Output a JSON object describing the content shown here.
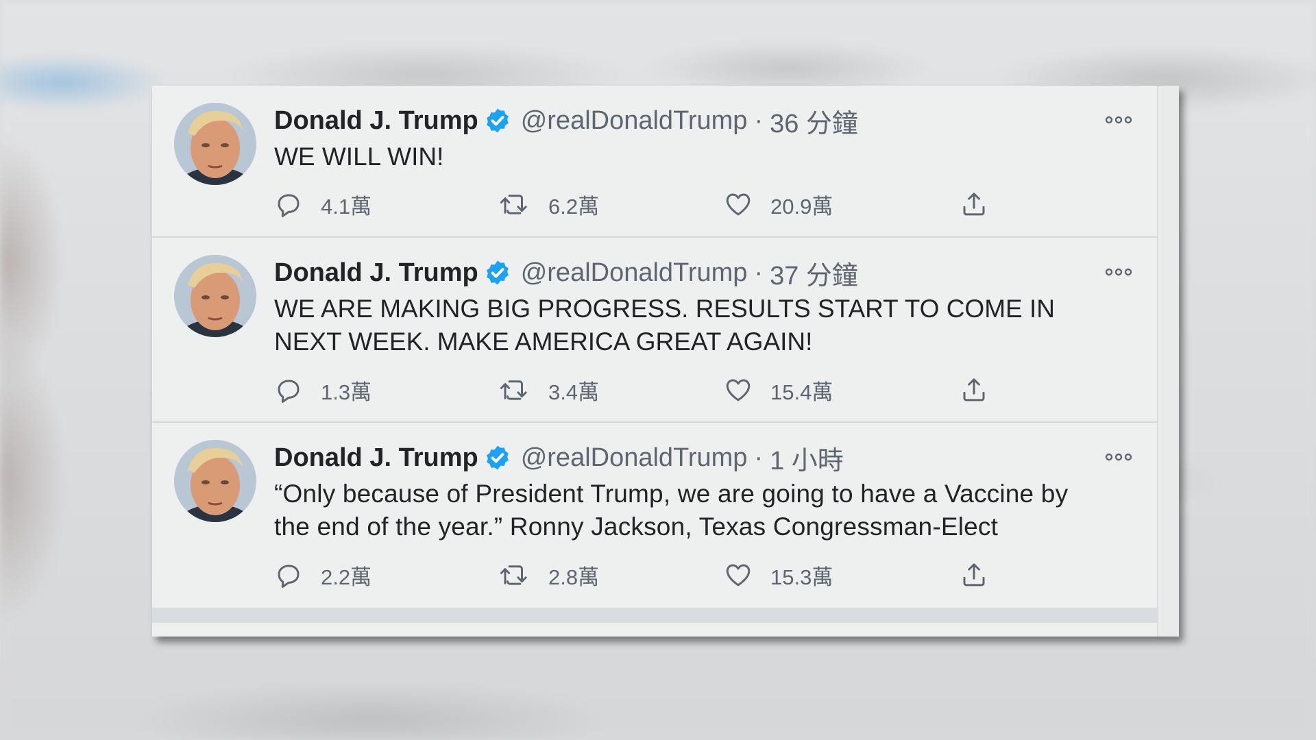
{
  "colors": {
    "verified": "#1da1f2",
    "text_primary": "#202427",
    "text_secondary": "#5d6670",
    "card_bg": "#eef0f0"
  },
  "tweets": [
    {
      "name": "Donald J. Trump",
      "handle": "@realDonaldTrump",
      "separator": "·",
      "time": "36 分鐘",
      "text": "WE WILL WIN!",
      "replies": "4.1萬",
      "retweets": "6.2萬",
      "likes": "20.9萬"
    },
    {
      "name": "Donald J. Trump",
      "handle": "@realDonaldTrump",
      "separator": "·",
      "time": "37 分鐘",
      "text": "WE ARE MAKING BIG PROGRESS. RESULTS START TO COME IN NEXT WEEK. MAKE AMERICA GREAT AGAIN!",
      "replies": "1.3萬",
      "retweets": "3.4萬",
      "likes": "15.4萬"
    },
    {
      "name": "Donald J. Trump",
      "handle": "@realDonaldTrump",
      "separator": "·",
      "time": "1 小時",
      "text": "“Only because of President Trump, we are going to have a Vaccine by the end of the year.”  Ronny Jackson, Texas Congressman-Elect",
      "replies": "2.2萬",
      "retweets": "2.8萬",
      "likes": "15.3萬"
    }
  ],
  "icons": {
    "reply": "reply-icon",
    "retweet": "retweet-icon",
    "like": "heart-icon",
    "share": "share-icon",
    "more": "more-icon",
    "verified": "verified-badge-icon"
  }
}
